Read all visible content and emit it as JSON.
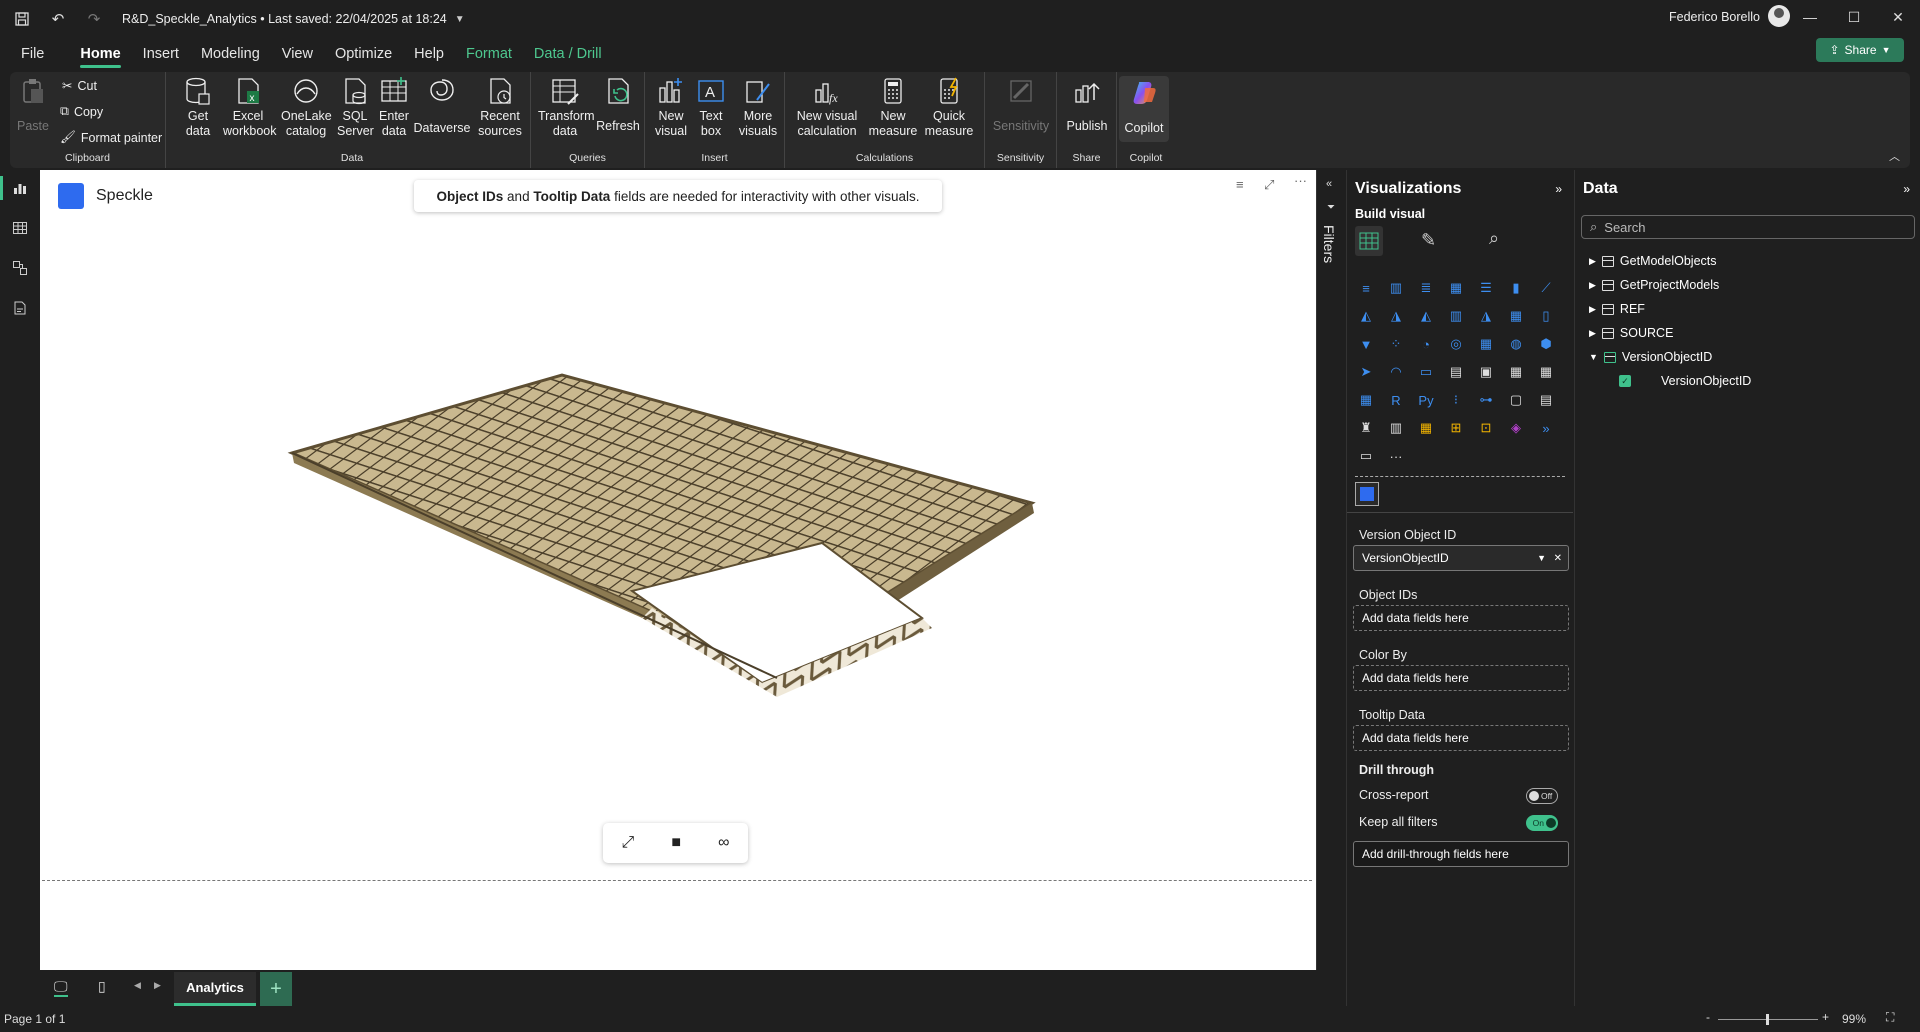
{
  "titlebar": {
    "doc_title": "R&D_Speckle_Analytics • Last saved: 22/04/2025 at 18:24",
    "user": "Federico Borello"
  },
  "menu": {
    "items": [
      {
        "label": "File"
      },
      {
        "label": "Home"
      },
      {
        "label": "Insert"
      },
      {
        "label": "Modeling"
      },
      {
        "label": "View"
      },
      {
        "label": "Optimize"
      },
      {
        "label": "Help"
      },
      {
        "label": "Format"
      },
      {
        "label": "Data / Drill"
      }
    ],
    "active": "Home",
    "share_label": "Share"
  },
  "ribbon": {
    "clipboard": {
      "paste": "Paste",
      "cut": "Cut",
      "copy": "Copy",
      "format_painter": "Format painter",
      "label": "Clipboard"
    },
    "data": {
      "get_data": "Get data",
      "excel": "Excel workbook",
      "onelake": "OneLake catalog",
      "sql": "SQL Server",
      "enter": "Enter data",
      "dataverse": "Dataverse",
      "recent": "Recent sources",
      "label": "Data"
    },
    "queries": {
      "transform": "Transform data",
      "refresh": "Refresh",
      "label": "Queries"
    },
    "insert": {
      "new_visual": "New visual",
      "text_box": "Text box",
      "more_visuals": "More visuals",
      "label": "Insert"
    },
    "calculations": {
      "new_visual_calc": "New visual calculation",
      "new_measure": "New measure",
      "quick_measure": "Quick measure",
      "label": "Calculations"
    },
    "sensitivity": {
      "btn": "Sensitivity",
      "label": "Sensitivity"
    },
    "share": {
      "publish": "Publish",
      "label": "Share"
    },
    "copilot": {
      "btn": "Copilot",
      "label": "Copilot"
    }
  },
  "visual": {
    "brand": "Speckle",
    "message_bold1": "Object IDs",
    "message_mid": " and ",
    "message_bold2": "Tooltip Data",
    "message_rest": " fields are needed for interactivity with other visuals."
  },
  "filters": {
    "label": "Filters"
  },
  "visualizations": {
    "title": "Visualizations",
    "build_visual": "Build visual",
    "wells": {
      "version_object_id": {
        "label": "Version Object ID",
        "value": "VersionObjectID"
      },
      "object_ids": {
        "label": "Object IDs",
        "placeholder": "Add data fields here"
      },
      "color_by": {
        "label": "Color By",
        "placeholder": "Add data fields here"
      },
      "tooltip_data": {
        "label": "Tooltip Data",
        "placeholder": "Add data fields here"
      }
    },
    "drill": {
      "title": "Drill through",
      "cross_report": "Cross-report",
      "cross_report_state": "Off",
      "keep_filters": "Keep all filters",
      "keep_filters_state": "On",
      "placeholder": "Add drill-through fields here"
    }
  },
  "data_pane": {
    "title": "Data",
    "search_placeholder": "Search",
    "tables": [
      {
        "name": "GetModelObjects"
      },
      {
        "name": "GetProjectModels"
      },
      {
        "name": "REF"
      },
      {
        "name": "SOURCE"
      },
      {
        "name": "VersionObjectID"
      }
    ],
    "field": "VersionObjectID"
  },
  "pages": {
    "active": "Analytics"
  },
  "status": {
    "page": "Page 1 of 1",
    "zoom": "99%"
  },
  "colors": {
    "accent": "#3fc18c",
    "speckle": "#2e6bef",
    "bg": "#1f1f1f"
  }
}
